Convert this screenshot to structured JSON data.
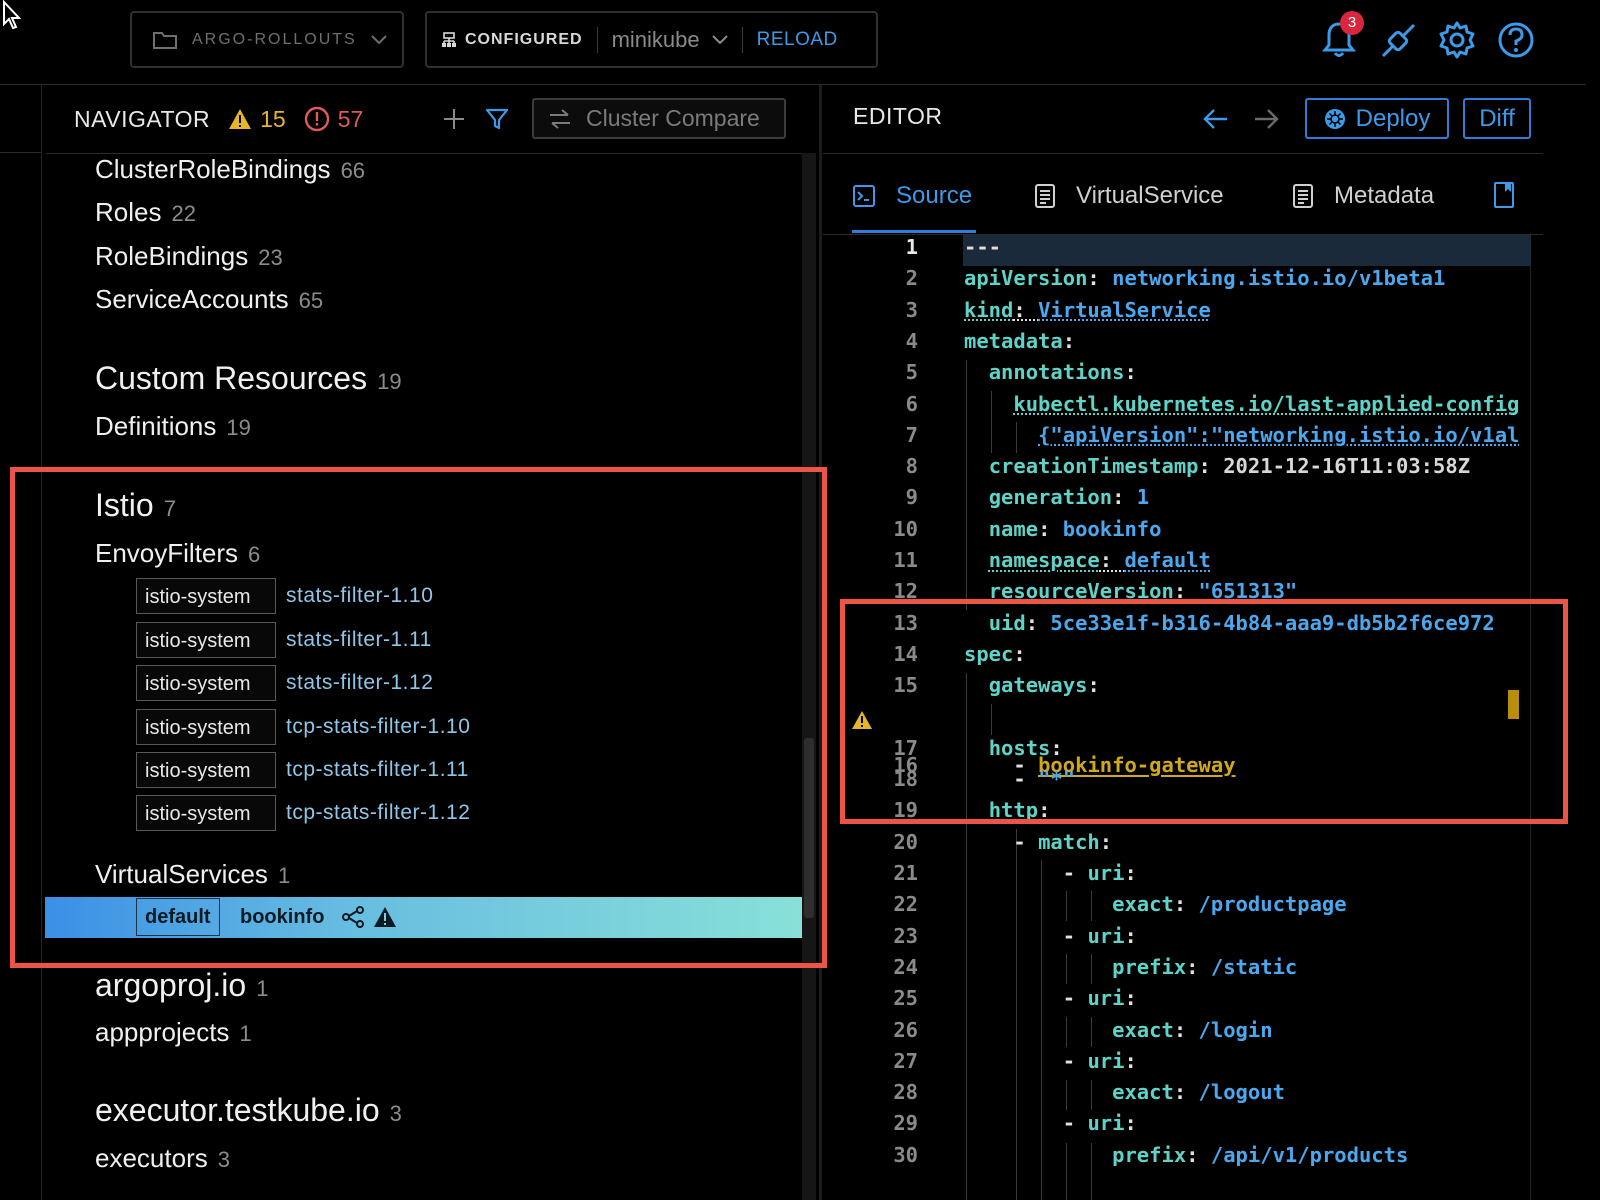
{
  "topbar": {
    "project": "ARGO-ROLLOUTS",
    "cluster_status": "CONFIGURED",
    "context": "minikube",
    "reload": "RELOAD",
    "notification_count": "3"
  },
  "navigator": {
    "title": "NAVIGATOR",
    "warning_count": "15",
    "error_count": "57",
    "compare_label": "Cluster Compare",
    "items": [
      {
        "label": "ClusterRoleBindings",
        "count": "66"
      },
      {
        "label": "Roles",
        "count": "22"
      },
      {
        "label": "RoleBindings",
        "count": "23"
      },
      {
        "label": "ServiceAccounts",
        "count": "65"
      }
    ],
    "custom_resources": {
      "label": "Custom Resources",
      "count": "19"
    },
    "definitions": {
      "label": "Definitions",
      "count": "19"
    },
    "istio": {
      "label": "Istio",
      "count": "7"
    },
    "envoyfilters": {
      "label": "EnvoyFilters",
      "count": "6"
    },
    "envoy_rows": [
      {
        "ns": "istio-system",
        "name": "stats-filter-1.10"
      },
      {
        "ns": "istio-system",
        "name": "stats-filter-1.11"
      },
      {
        "ns": "istio-system",
        "name": "stats-filter-1.12"
      },
      {
        "ns": "istio-system",
        "name": "tcp-stats-filter-1.10"
      },
      {
        "ns": "istio-system",
        "name": "tcp-stats-filter-1.11"
      },
      {
        "ns": "istio-system",
        "name": "tcp-stats-filter-1.12"
      }
    ],
    "virtualservices": {
      "label": "VirtualServices",
      "count": "1"
    },
    "selected": {
      "ns": "default",
      "name": "bookinfo"
    },
    "argoproj": {
      "label": "argoproj.io",
      "count": "1"
    },
    "appprojects": {
      "label": "appprojects",
      "count": "1"
    },
    "testkube": {
      "label": "executor.testkube.io",
      "count": "3"
    },
    "executors": {
      "label": "executors",
      "count": "3"
    }
  },
  "editor": {
    "title": "EDITOR",
    "deploy": "Deploy",
    "diff": "Diff",
    "tabs": [
      "Source",
      "VirtualService",
      "Metadata"
    ],
    "line_numbers": [
      "1",
      "2",
      "3",
      "4",
      "5",
      "6",
      "7",
      "8",
      "9",
      "10",
      "11",
      "12",
      "13",
      "14",
      "15",
      "16",
      "17",
      "18",
      "19",
      "20",
      "21",
      "22",
      "23",
      "24",
      "25",
      "26",
      "27",
      "28",
      "29",
      "30"
    ],
    "code": {
      "l1": "---",
      "l2_k": "apiVersion",
      "l2_v": "networking.istio.io/v1beta1",
      "l3_k": "kind",
      "l3_v": "VirtualService",
      "l4_k": "metadata",
      "l5_k": "annotations",
      "l6_k": "kubectl.kubernetes.io/last-applied-config",
      "l7_v": "{\"apiVersion\":\"networking.istio.io/v1al",
      "l8_k": "creationTimestamp",
      "l8_v": "2021-12-16T11:03:58Z",
      "l9_k": "generation",
      "l9_v": "1",
      "l10_k": "name",
      "l10_v": "bookinfo",
      "l11_k": "namespace",
      "l11_v": "default",
      "l12_k": "resourceVersion",
      "l12_v": "\"651313\"",
      "l13_k": "uid",
      "l13_v": "5ce33e1f-b316-4b84-aaa9-db5b2f6ce972",
      "l14_k": "spec",
      "l15_k": "gateways",
      "l16_v": "bookinfo-gateway",
      "l17_k": "hosts",
      "l18_v": "\"*\"",
      "l19_k": "http",
      "l20_k": "match",
      "l21_k": "uri",
      "l22_k": "exact",
      "l22_v": "/productpage",
      "l23_k": "uri",
      "l24_k": "prefix",
      "l24_v": "/static",
      "l25_k": "uri",
      "l26_k": "exact",
      "l26_v": "/login",
      "l27_k": "uri",
      "l28_k": "exact",
      "l28_v": "/logout",
      "l29_k": "uri",
      "l30_k": "prefix",
      "l30_v": "/api/v1/products"
    }
  },
  "colors": {
    "accent": "#3d9ae9",
    "highlight": "#ec5448",
    "warning": "#e6b62a",
    "error": "#e05a5a"
  },
  "icons": [
    "cursor-icon",
    "folder-icon",
    "chevron-down-icon",
    "cluster-icon",
    "bell-icon",
    "plug-icon",
    "gear-icon",
    "help-icon",
    "warning-icon",
    "error-icon",
    "plus-icon",
    "filter-icon",
    "compare-icon",
    "arrow-left-icon",
    "arrow-right-icon",
    "helm-icon",
    "terminal-icon",
    "document-icon",
    "bookmark-icon",
    "share-icon"
  ]
}
